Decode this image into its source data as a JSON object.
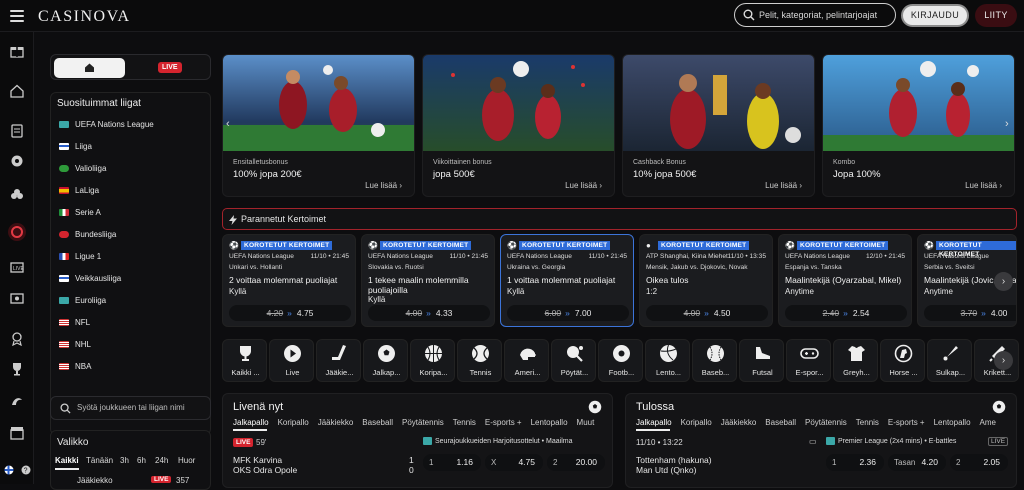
{
  "header": {
    "logo": "CASINOVA",
    "search_placeholder": "Pelit, kategoriat, pelintarjoajat",
    "login_label": "KIRJAUDU",
    "join_label": "LIITY"
  },
  "sidebar": {
    "live_label": "LIVE",
    "leagues_title": "Suosituimmat liigat",
    "leagues": [
      "UEFA Nations League",
      "Liiga",
      "Valioliiga",
      "LaLiga",
      "Serie A",
      "Bundesliiga",
      "Ligue 1",
      "Veikkausliiga",
      "Euroliiga",
      "NFL",
      "NHL",
      "NBA"
    ],
    "search_placeholder": "Syötä joukkueen tai liigan nimi",
    "valikko_title": "Valikko",
    "valikko_tabs": [
      "Kaikki",
      "Tänään",
      "3h",
      "6h",
      "24h",
      "Huor"
    ],
    "valikko_row": {
      "label": "Jääkiekko",
      "live": "LIVE",
      "count": "357"
    }
  },
  "banners": [
    {
      "caption": "Ensitalletusbonus",
      "title": "100% jopa 200€",
      "more": "Lue lisää"
    },
    {
      "caption": "Viikoittainen bonus",
      "title": "jopa 500€",
      "more": "Lue lisää"
    },
    {
      "caption": "Cashback Bonus",
      "title": "10% jopa 500€",
      "more": "Lue lisää"
    },
    {
      "caption": "Kombo",
      "title": "Jopa 100%",
      "more": "Lue lisää"
    }
  ],
  "boosted": {
    "title": "Parannetut Kertoimet",
    "badge": "KOROTETUT KERTOIMET",
    "cards": [
      {
        "league": "UEFA Nations League",
        "time": "11/10 • 21:45",
        "teams": "Unkari vs. Hollanti",
        "market": "2 voittaa molemmat puoliajat",
        "sub": "Kyllä",
        "old": "4.20",
        "new": "4.75"
      },
      {
        "league": "UEFA Nations League",
        "time": "11/10 • 21:45",
        "teams": "Slovakia vs. Ruotsi",
        "market": "1 tekee maalin molemmilla puoliajoilla",
        "sub": "Kyllä",
        "old": "4.00",
        "new": "4.33"
      },
      {
        "league": "UEFA Nations League",
        "time": "11/10 • 21:45",
        "teams": "Ukraina vs. Georgia",
        "market": "1 voittaa molemmat puoliajat",
        "sub": "Kyllä",
        "old": "6.00",
        "new": "7.00"
      },
      {
        "league": "ATP Shanghai, Kiina Miehet",
        "time": "11/10 • 13:35",
        "teams": "Mensik, Jakub vs. Djokovic, Novak",
        "market": "Oikea tulos",
        "sub": "1:2",
        "old": "4.00",
        "new": "4.50"
      },
      {
        "league": "UEFA Nations League",
        "time": "12/10 • 21:45",
        "teams": "Espanja vs. Tanska",
        "market": "Maalintekijä (Oyarzabal, Mikel)",
        "sub": "Anytime",
        "old": "2.40",
        "new": "2.54"
      },
      {
        "league": "UEFA Nations League",
        "time": "12/10 • 21:45",
        "teams": "Serbia vs. Sveitsi",
        "market": "Maalintekijä (Jovic, Luka)",
        "sub": "Anytime",
        "old": "3.70",
        "new": "4.00"
      }
    ]
  },
  "sports": [
    "Kaikki ...",
    "Live",
    "Jääkie...",
    "Jalkap...",
    "Koripa...",
    "Tennis",
    "Ameri...",
    "Pöytät...",
    "Footb...",
    "Lento...",
    "Baseb...",
    "Futsal",
    "E-spor...",
    "Greyh...",
    "Horse ...",
    "Sulkap...",
    "Krikett..."
  ],
  "live_panel": {
    "title": "Livenä nyt",
    "tabs": [
      "Jalkapallo",
      "Koripallo",
      "Jääkiekko",
      "Baseball",
      "Pöytätennis",
      "Tennis",
      "E-sports +",
      "Lentopallo",
      "Muut"
    ],
    "live_badge": "LIVE",
    "minute": "59'",
    "league": "Seurajoukkueiden Harjoitusottelut • Maailma",
    "home": "MFK Karvina",
    "away": "OKS Odra Opole",
    "score_home": "1",
    "score_away": "0",
    "odds": [
      {
        "k": "1",
        "v": "1.16"
      },
      {
        "k": "X",
        "v": "4.75"
      },
      {
        "k": "2",
        "v": "20.00"
      }
    ]
  },
  "upcoming_panel": {
    "title": "Tulossa",
    "tabs": [
      "Jalkapallo",
      "Koripallo",
      "Jääkiekko",
      "Baseball",
      "Pöytätennis",
      "Tennis",
      "E-sports +",
      "Lentopallo",
      "Ame"
    ],
    "time": "11/10 • 13:22",
    "league": "Premier League (2x4 mins) • E-battles",
    "live_badge": "LIVE",
    "home": "Tottenham (hakuna)",
    "away": "Man Utd (Qnko)",
    "odds": [
      {
        "k": "1",
        "v": "2.36"
      },
      {
        "k": "Tasan",
        "v": "4.20"
      },
      {
        "k": "2",
        "v": "2.05"
      }
    ]
  }
}
